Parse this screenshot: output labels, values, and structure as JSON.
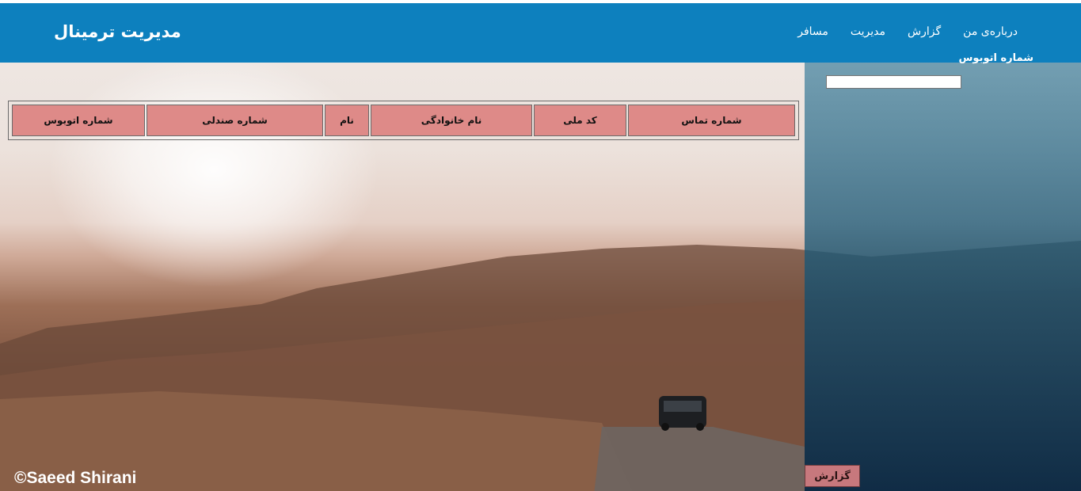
{
  "header": {
    "brand": "مدیریت ترمینال",
    "nav": [
      "درباره‌ی من",
      "گزارش",
      "مدیریت",
      "مسافر"
    ]
  },
  "search": {
    "label": "شماره اتوبوس",
    "value": ""
  },
  "table": {
    "columns": [
      "شماره تماس",
      "کد ملی",
      "نام خانوادگی",
      "نام",
      "شماره صندلی",
      "شماره اتوبوس"
    ]
  },
  "report_button": "گزارش",
  "credit": "©Saeed Shirani",
  "colors": {
    "header_bg": "#0d80be",
    "table_header_bg": "#de8a88",
    "button_bg": "#c7787d"
  }
}
